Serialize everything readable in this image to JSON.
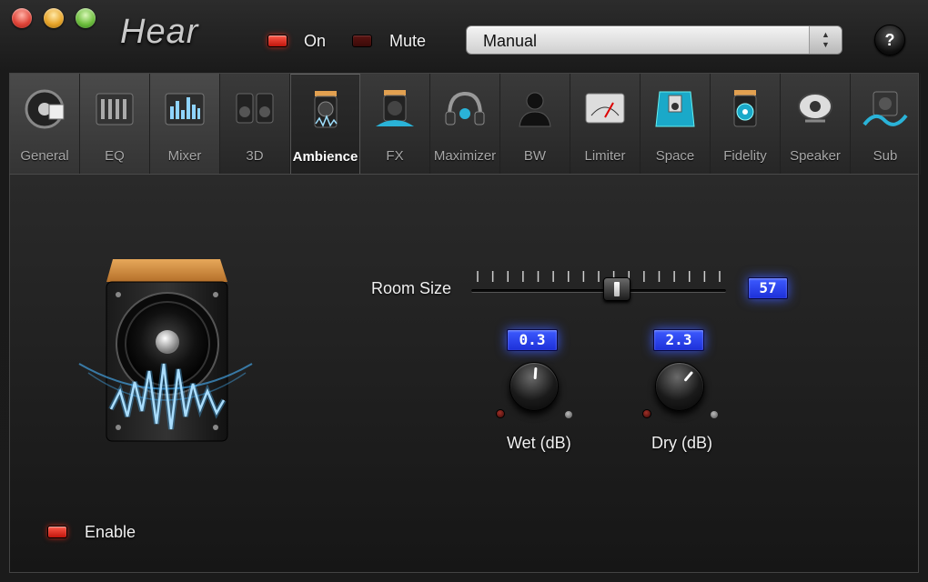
{
  "window": {
    "title": "Hear",
    "power_label": "On",
    "mute_label": "Mute",
    "preset": {
      "selected": "Manual"
    },
    "help_label": "?"
  },
  "tabs": [
    {
      "label": "General",
      "icon": "speaker-dial-icon"
    },
    {
      "label": "EQ",
      "icon": "eq-sliders-icon"
    },
    {
      "label": "Mixer",
      "icon": "mixer-meter-icon"
    },
    {
      "label": "3D",
      "icon": "speakers-3d-icon"
    },
    {
      "label": "Ambience",
      "icon": "ambience-speaker-icon",
      "active": true
    },
    {
      "label": "FX",
      "icon": "fx-speaker-icon"
    },
    {
      "label": "Maximizer",
      "icon": "headphones-icon"
    },
    {
      "label": "BW",
      "icon": "person-bust-icon"
    },
    {
      "label": "Limiter",
      "icon": "vu-meter-icon"
    },
    {
      "label": "Space",
      "icon": "space-room-icon"
    },
    {
      "label": "Fidelity",
      "icon": "fidelity-speaker-icon"
    },
    {
      "label": "Speaker",
      "icon": "speaker-driver-icon"
    },
    {
      "label": "Sub",
      "icon": "subwoofer-icon"
    }
  ],
  "ambience": {
    "room_size": {
      "label": "Room Size",
      "value": "57",
      "level": 0.57
    },
    "wet": {
      "label": "Wet (dB)",
      "value": "0.3"
    },
    "dry": {
      "label": "Dry (dB)",
      "value": "2.3"
    },
    "enable_label": "Enable"
  },
  "colors": {
    "lcd_blue": "#2a44ff",
    "led_red": "#e0261a"
  }
}
